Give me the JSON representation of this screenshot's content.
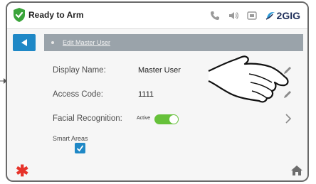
{
  "status": {
    "arm_text": "Ready to Arm",
    "brand": "2GIG"
  },
  "header": {
    "title": "Edit Master User"
  },
  "rows": [
    {
      "label": "Display Name:",
      "value": "Master User"
    },
    {
      "label": "Access Code:",
      "value": "1111"
    },
    {
      "label": "Facial Recognition:",
      "value": "Active"
    }
  ],
  "smart_areas": {
    "label": "Smart Areas",
    "checked": true
  },
  "colors": {
    "accent": "#1f88c6",
    "ok": "#3aa43a",
    "toggle_on": "#66c13a",
    "emergency": "#e6332a"
  },
  "icons": [
    "shield-check-icon",
    "phone-icon",
    "speaker-icon",
    "camera-icon",
    "back-arrow-icon",
    "pencil-icon",
    "chevron-right-icon",
    "home-icon",
    "hand-pointer-icon"
  ]
}
